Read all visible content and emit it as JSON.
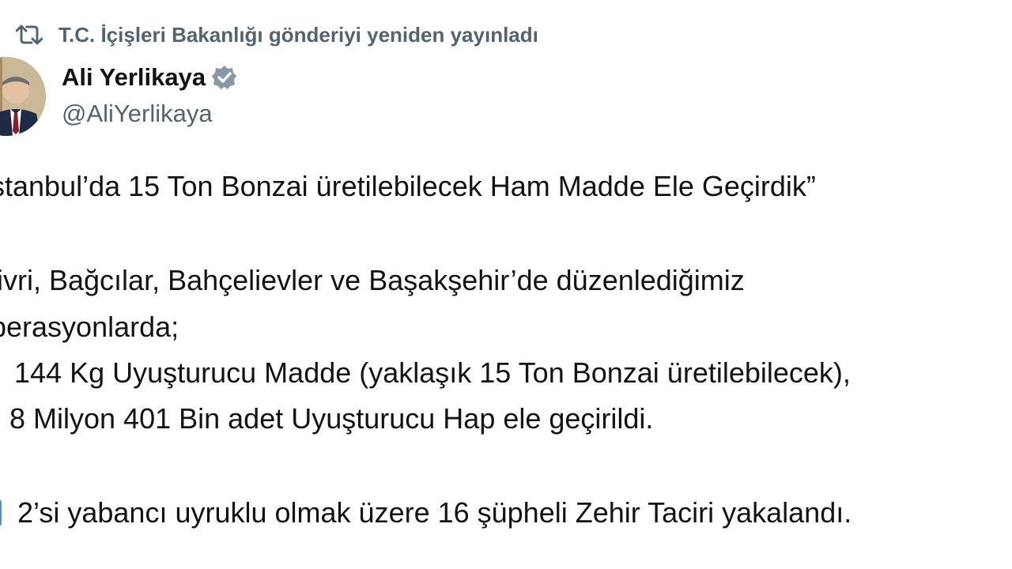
{
  "retweet": {
    "text": "T.C. İçişleri Bakanlığı gönderiyi yeniden yayınladı",
    "icon": "repost-icon"
  },
  "author": {
    "name": "Ali Yerlikaya",
    "handle": "@AliYerlikaya",
    "verified_icon": "verified-badge-icon",
    "verified_color": "#8899a6"
  },
  "tweet": {
    "lines": [
      "stanbul’da 15 Ton Bonzai üretilebilecek Ham Madde Ele Geçirdik”",
      "livri, Bağcılar, Bahçelievler ve Başakşehir’de düzenlediğimiz",
      "perasyonlarda;",
      "144 Kg Uyuşturucu Madde (yaklaşık 15 Ton Bonzai üretilebilecek),",
      "8 Milyon 401 Bin adet Uyuşturucu Hap ele geçirildi.",
      "2’si yabancı uyruklu olmak üzere 16 şüpheli Zehir Taciri yakalandı."
    ]
  },
  "colors": {
    "text_primary": "#0f1419",
    "text_secondary": "#536471",
    "bullet_triangle": "#e0245e",
    "bullet_square": "#4a8fd6"
  }
}
